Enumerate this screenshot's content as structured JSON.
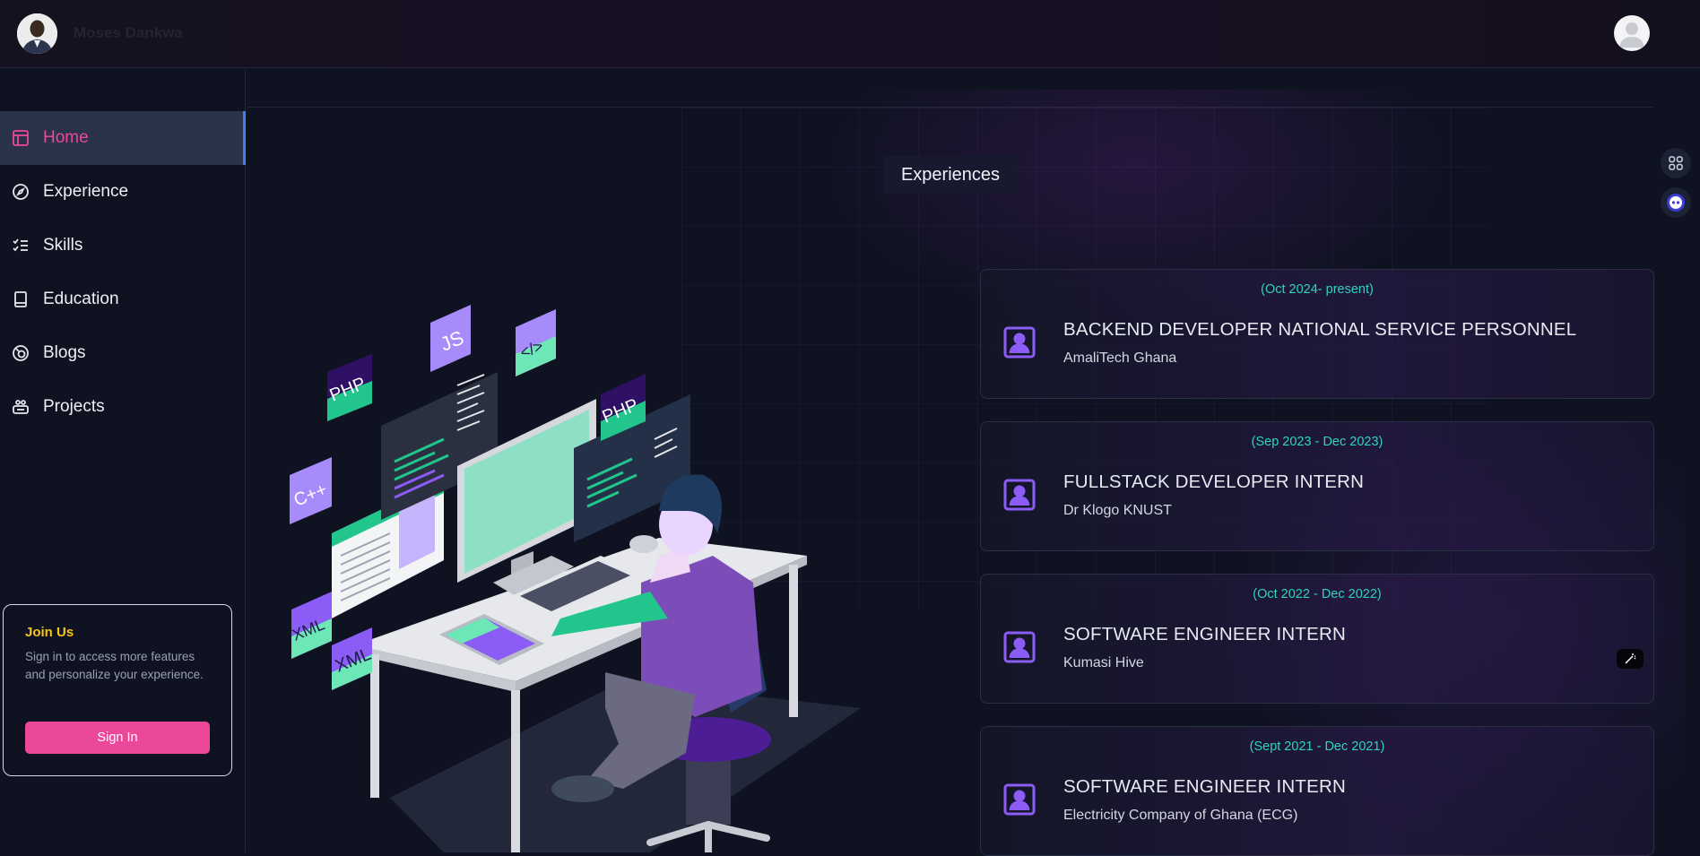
{
  "header": {
    "brand_name": "Moses Dankwa",
    "avatar_icon": "profile-photo",
    "user_icon": "user-avatar-icon"
  },
  "sidebar": {
    "items": [
      {
        "label": "Home",
        "icon": "layout-icon",
        "active": true
      },
      {
        "label": "Experience",
        "icon": "compass-icon",
        "active": false
      },
      {
        "label": "Skills",
        "icon": "checklist-icon",
        "active": false
      },
      {
        "label": "Education",
        "icon": "book-icon",
        "active": false
      },
      {
        "label": "Blogs",
        "icon": "blog-icon",
        "active": false
      },
      {
        "label": "Projects",
        "icon": "projects-icon",
        "active": false
      }
    ],
    "join": {
      "title": "Join Us",
      "text": "Sign in to access more features and personalize your experience.",
      "button": "Sign In"
    }
  },
  "main": {
    "section_title": "Experiences",
    "illustration_labels": [
      "PHP",
      "JS",
      "</>",
      "PHP",
      "C++",
      "XML"
    ],
    "experiences": [
      {
        "date": "(Oct 2024- present)",
        "title": "BACKEND DEVELOPER NATIONAL SERVICE PERSONNEL",
        "org": "AmaliTech Ghana"
      },
      {
        "date": "(Sep 2023 - Dec 2023)",
        "title": "FULLSTACK DEVELOPER INTERN",
        "org": "Dr Klogo KNUST"
      },
      {
        "date": "(Oct 2022 - Dec 2022)",
        "title": "SOFTWARE ENGINEER INTERN",
        "org": "Kumasi Hive"
      },
      {
        "date": "(Sept 2021 - Dec 2021)",
        "title": "SOFTWARE ENGINEER INTERN",
        "org": "Electricity Company of Ghana (ECG)"
      }
    ]
  },
  "colors": {
    "accent_pink": "#ec4899",
    "accent_teal": "#2dd4bf",
    "accent_yellow": "#f5c518",
    "active_bar": "#3b82f6",
    "background": "#0f1221"
  }
}
